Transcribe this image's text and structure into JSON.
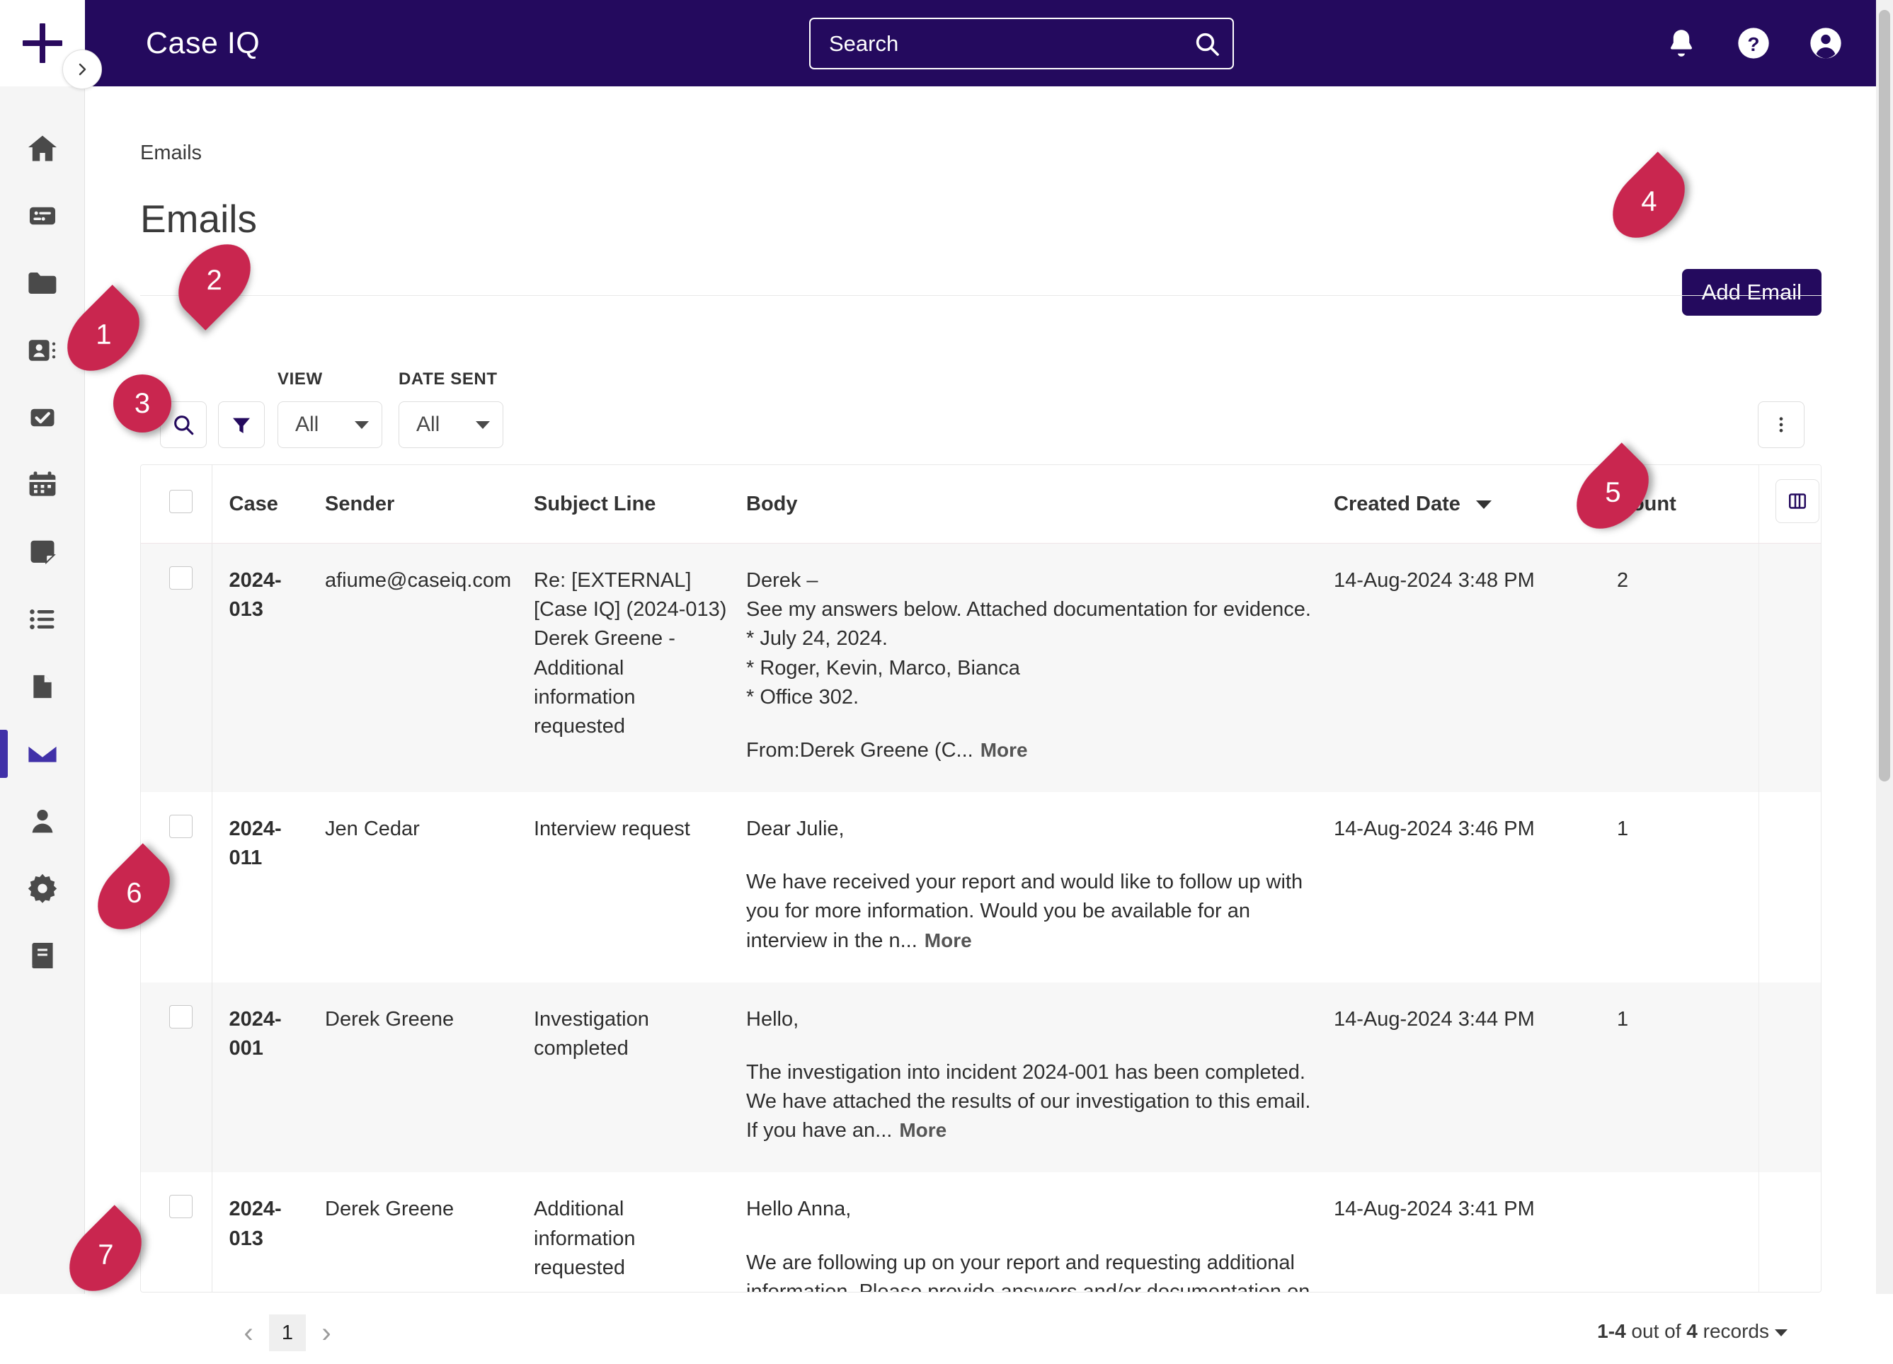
{
  "topbar": {
    "add_icon": "plus-icon",
    "brand": "Case IQ",
    "search": {
      "placeholder": "Search",
      "value": "",
      "icon": "search-icon"
    },
    "icons": [
      {
        "name": "bell-icon",
        "label": "Notifications"
      },
      {
        "name": "help-icon",
        "label": "Help"
      },
      {
        "name": "account-icon",
        "label": "Account"
      }
    ]
  },
  "sidebar": {
    "collapse_icon": "chevron-right-icon",
    "items": [
      {
        "name": "home-icon",
        "label": "Home",
        "active": false
      },
      {
        "name": "dashboard-icon",
        "label": "Dashboard",
        "active": false
      },
      {
        "name": "folder-icon",
        "label": "Cases",
        "active": false
      },
      {
        "name": "contacts-icon",
        "label": "Parties",
        "active": false
      },
      {
        "name": "tasks-icon",
        "label": "Tasks",
        "active": false
      },
      {
        "name": "calendar-icon",
        "label": "Calendar",
        "active": false
      },
      {
        "name": "notes-icon",
        "label": "Notes",
        "active": false
      },
      {
        "name": "list-icon",
        "label": "Lists",
        "active": false
      },
      {
        "name": "file-icon",
        "label": "Files",
        "active": false
      },
      {
        "name": "email-icon",
        "label": "Emails",
        "active": true
      },
      {
        "name": "person-icon",
        "label": "Users",
        "active": false
      },
      {
        "name": "gear-icon",
        "label": "Settings",
        "active": false
      },
      {
        "name": "book-icon",
        "label": "Library",
        "active": false
      }
    ]
  },
  "page": {
    "breadcrumb": "Emails",
    "title": "Emails",
    "add_button": "Add Email"
  },
  "toolbar": {
    "search_icon": "search-icon",
    "filter_icon": "funnel-icon",
    "kebab_icon": "more-vertical-icon",
    "view_label": "VIEW",
    "view_value": "All",
    "date_label": "DATE SENT",
    "date_value": "All"
  },
  "table": {
    "columns": [
      "Case",
      "Sender",
      "Subject Line",
      "Body",
      "Created Date",
      "Count"
    ],
    "sorted_column": "Created Date",
    "sort_direction": "desc",
    "column_config_icon": "column-settings-icon",
    "more_label": "More",
    "rows": [
      {
        "case": "2024-013",
        "sender": "afiume@caseiq.com",
        "subject": "Re: [EXTERNAL] [Case IQ] (2024-013) Derek Greene - Additional information requested",
        "body_lines": [
          "Derek –",
          "See my answers below. Attached documentation for evidence.",
          "* July 24, 2024.",
          "* Roger, Kevin, Marco, Bianca",
          "* Office 302.",
          "",
          "From:Derek Greene (C..."
        ],
        "created_date": "14-Aug-2024 3:48 PM",
        "count": "2"
      },
      {
        "case": "2024-011",
        "sender": "Jen Cedar",
        "subject": "Interview request",
        "body_lines": [
          "Dear Julie,",
          "",
          "We have received your report and would like to follow up with you for more information. Would you be available for an interview in the n..."
        ],
        "created_date": "14-Aug-2024 3:46 PM",
        "count": "1"
      },
      {
        "case": "2024-001",
        "sender": "Derek Greene",
        "subject": "Investigation completed",
        "body_lines": [
          "Hello,",
          "",
          "The investigation into incident 2024-001 has been completed. We have attached the results of our investigation to this email. If you have an..."
        ],
        "created_date": "14-Aug-2024 3:44 PM",
        "count": "1"
      },
      {
        "case": "2024-013",
        "sender": "Derek Greene",
        "subject": "Additional information requested",
        "body_lines": [
          "Hello Anna,",
          "",
          "We are following up on your report and requesting additional information. Please provide answers and/or documentation on the following ..."
        ],
        "created_date": "14-Aug-2024 3:41 PM",
        "count": ""
      }
    ]
  },
  "footer": {
    "prev_icon": "chevron-left-icon",
    "next_icon": "chevron-right-icon",
    "current_page": "1",
    "records_range": "1-4",
    "records_middle": " out of ",
    "records_total": "4",
    "records_suffix": " records"
  },
  "markers": [
    {
      "id": "1",
      "shape": "pin-right",
      "target": "search-toggle-button"
    },
    {
      "id": "2",
      "shape": "pin-down",
      "target": "filter-toggle-button"
    },
    {
      "id": "3",
      "shape": "circle",
      "target": "select-all-checkbox"
    },
    {
      "id": "4",
      "shape": "pin-right",
      "target": "add-email-button"
    },
    {
      "id": "5",
      "shape": "pin-right",
      "target": "count-cell"
    },
    {
      "id": "6",
      "shape": "pin-right",
      "target": "row-checkbox"
    },
    {
      "id": "7",
      "shape": "pin-right",
      "target": "pagination"
    }
  ],
  "colors": {
    "brand_purple": "#240A5E",
    "accent_purple": "#4030A8",
    "marker_red": "#C9264F",
    "rail_bg": "#F5F5F5"
  }
}
